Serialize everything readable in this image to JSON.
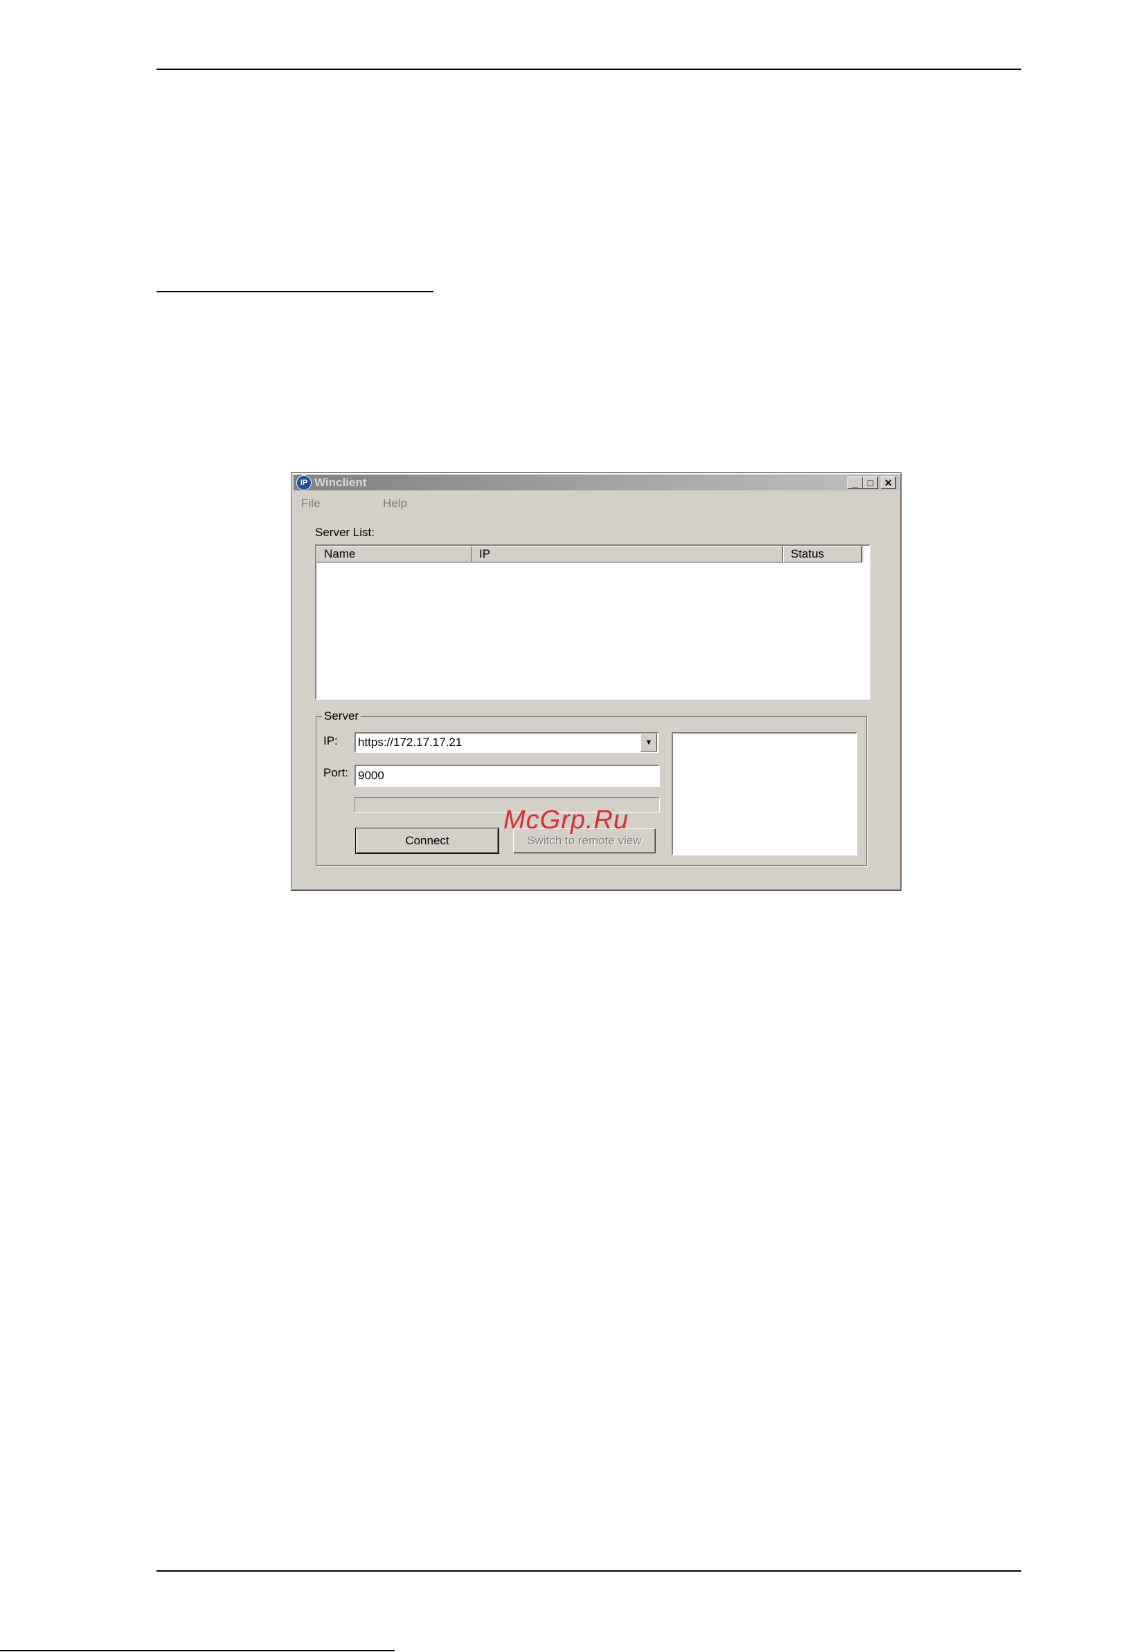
{
  "window": {
    "title": "Winclient",
    "icon": "ip-logo-icon",
    "icon_text": "IP",
    "controls": {
      "minimize": "_",
      "maximize": "□",
      "close": "✕"
    }
  },
  "menu": {
    "file": "File",
    "help": "Help"
  },
  "server_list": {
    "label": "Server List:",
    "columns": [
      "Name",
      "IP",
      "Status"
    ],
    "rows": []
  },
  "server_group": {
    "legend": "Server",
    "ip_label": "IP:",
    "ip_value": "https://172.17.17.21",
    "port_label": "Port:",
    "port_value": "9000",
    "progress": 0,
    "connect_label": "Connect",
    "switch_label": "Switch to remote view"
  },
  "watermark": "McGrp.Ru"
}
